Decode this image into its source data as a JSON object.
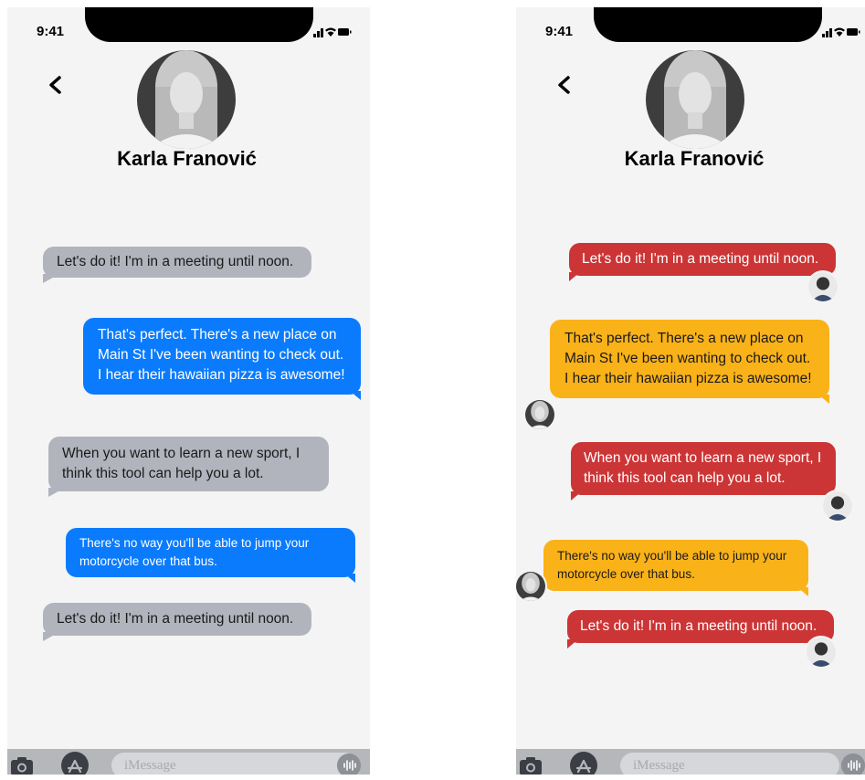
{
  "status_time": "9:41",
  "contact_name": "Karla Franović",
  "input_placeholder": "iMessage",
  "messages": [
    {
      "text": "Let's do it! I'm in a meeting until noon."
    },
    {
      "text": "That's perfect. There's a new place on Main St I've been wanting to check out. I hear their hawaiian pizza is awesome!"
    },
    {
      "text": "When you want to learn a new sport, I think this tool can help you a lot."
    },
    {
      "text": "There's no way you'll be able to jump your motorcycle over that bus."
    },
    {
      "text": "Let's do it! I'm in a meeting until noon."
    }
  ],
  "colors": {
    "received_gray": "#b1b4bd",
    "sent_blue": "#0a7bfd",
    "contact_red": "#cc3536",
    "user_yellow": "#fab219"
  },
  "icons": [
    "signal-icon",
    "wifi-icon",
    "battery-icon",
    "back-chevron-icon",
    "camera-icon",
    "app-store-icon",
    "audio-icon"
  ]
}
